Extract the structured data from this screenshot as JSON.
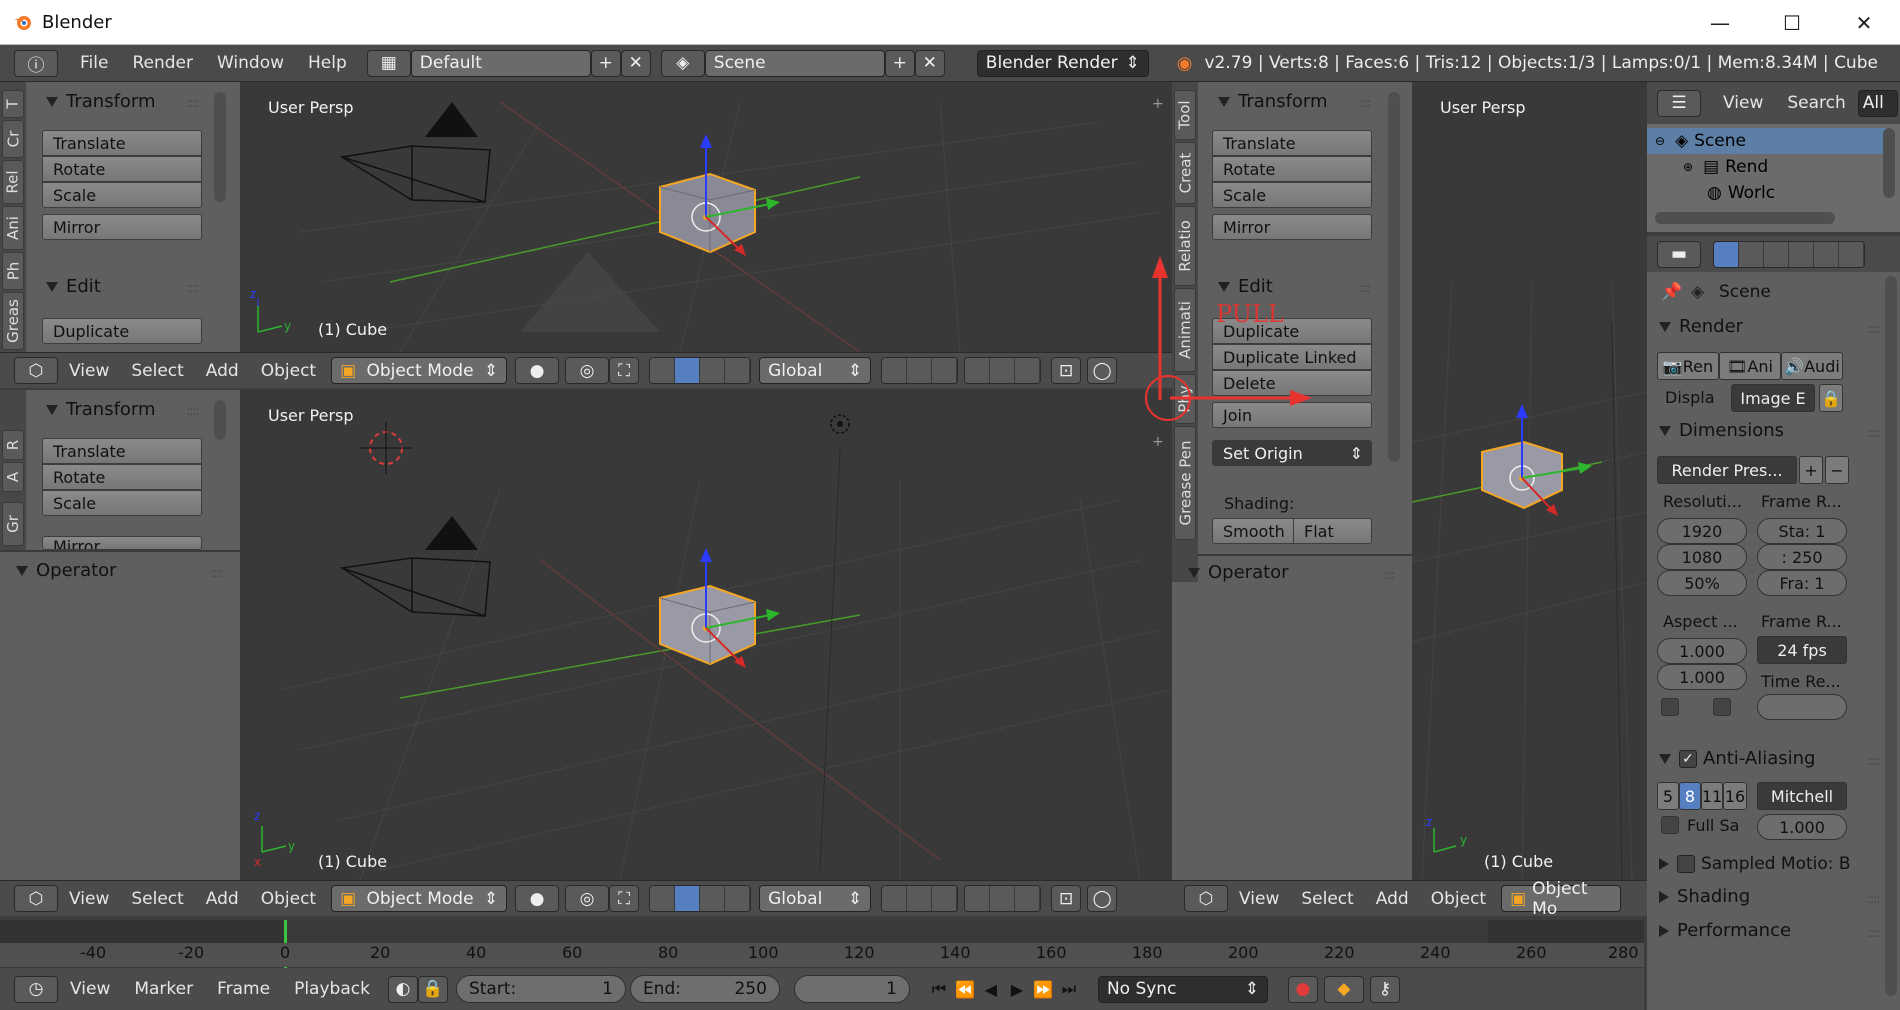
{
  "window": {
    "title": "Blender",
    "minimize": "—",
    "maximize": "☐",
    "close": "✕"
  },
  "infobar": {
    "menus": [
      "File",
      "Render",
      "Window",
      "Help"
    ],
    "layout": "Default",
    "scene": "Scene",
    "engine": "Blender Render",
    "stats": "v2.79 | Verts:8 | Faces:6 | Tris:12 | Objects:1/3 | Lamps:0/1 | Mem:8.34M | Cube"
  },
  "toolshelf_left_top": {
    "tabs": [
      "T",
      "Cr",
      "Rel",
      "Ani",
      "Ph",
      "Greas"
    ],
    "transform_title": "Transform",
    "buttons": [
      "Translate",
      "Rotate",
      "Scale",
      "Mirror"
    ],
    "edit_title": "Edit",
    "duplicate": "Duplicate"
  },
  "toolshelf_left_bottom": {
    "tabs": [
      "R",
      "A",
      "Gr"
    ],
    "transform_title": "Transform",
    "buttons": [
      "Translate",
      "Rotate",
      "Scale",
      "Mirror"
    ],
    "operator_title": "Operator"
  },
  "viewport_top": {
    "persp": "User Persp",
    "object": "(1) Cube"
  },
  "viewport_bottom": {
    "persp": "User Persp",
    "object": "(1) Cube"
  },
  "viewport_right": {
    "persp": "User Persp",
    "object": "(1) Cube"
  },
  "view3d_header": {
    "menus": [
      "View",
      "Select",
      "Add",
      "Object"
    ],
    "mode": "Object Mode",
    "orientation": "Global"
  },
  "view3d_header_right": {
    "menus": [
      "View",
      "Select",
      "Add",
      "Object"
    ],
    "mode": "Object Mo"
  },
  "toolshelf_center": {
    "tabs": [
      "Tool",
      "Creat",
      "Relatio",
      "Animati",
      "Phy",
      "Grease Pen"
    ],
    "transform_title": "Transform",
    "buttons": [
      "Translate",
      "Rotate",
      "Scale",
      "Mirror"
    ],
    "edit_title": "Edit",
    "edit_buttons": [
      "Duplicate",
      "Duplicate Linked",
      "Delete",
      "Join"
    ],
    "set_origin": "Set Origin",
    "shading_label": "Shading:",
    "smooth": "Smooth",
    "flat": "Flat",
    "operator_title": "Operator",
    "annotation": "PULL"
  },
  "outliner": {
    "menus": [
      "View",
      "Search",
      "All"
    ],
    "items": [
      "Scene",
      "Rend",
      "Worlc"
    ]
  },
  "properties": {
    "context": "Scene",
    "render_title": "Render",
    "render_buttons": [
      "Ren",
      "Ani",
      "Audi"
    ],
    "display_label": "Displa",
    "display_value": "Image E",
    "dimensions_title": "Dimensions",
    "render_presets": "Render Pres...",
    "resolution_label": "Resoluti...",
    "res_x": "1920",
    "res_y": "1080",
    "res_pct": "50%",
    "frame_range_label": "Frame R...",
    "start": "Sta: 1",
    "end": ": 250",
    "step": "Fra: 1",
    "aspect_label": "Aspect ...",
    "aspect_x": "1.000",
    "aspect_y": "1.000",
    "frame_rate_label": "Frame R...",
    "fps": "24 fps",
    "time_remap_label": "Time Re...",
    "aa_title": "Anti-Aliasing",
    "aa_samples": [
      "5",
      "8",
      "11",
      "16"
    ],
    "aa_filter": "Mitchell",
    "full_sample": "Full Sa",
    "filter_size": "1.000",
    "sampled_motion": "Sampled Motio: B",
    "shading_title": "Shading",
    "performance_title": "Performance"
  },
  "timeline": {
    "ruler_ticks": [
      "-40",
      "-20",
      "0",
      "20",
      "40",
      "60",
      "80",
      "100",
      "120",
      "140",
      "160",
      "180",
      "200",
      "220",
      "240",
      "260",
      "280"
    ],
    "menus": [
      "View",
      "Marker",
      "Frame",
      "Playback"
    ],
    "start_label": "Start:",
    "start_value": "1",
    "end_label": "End:",
    "end_value": "250",
    "current": "1",
    "sync": "No Sync"
  },
  "colors": {
    "accent": "#5680c2",
    "annotation": "#e8332e",
    "orange": "#f5a623"
  }
}
